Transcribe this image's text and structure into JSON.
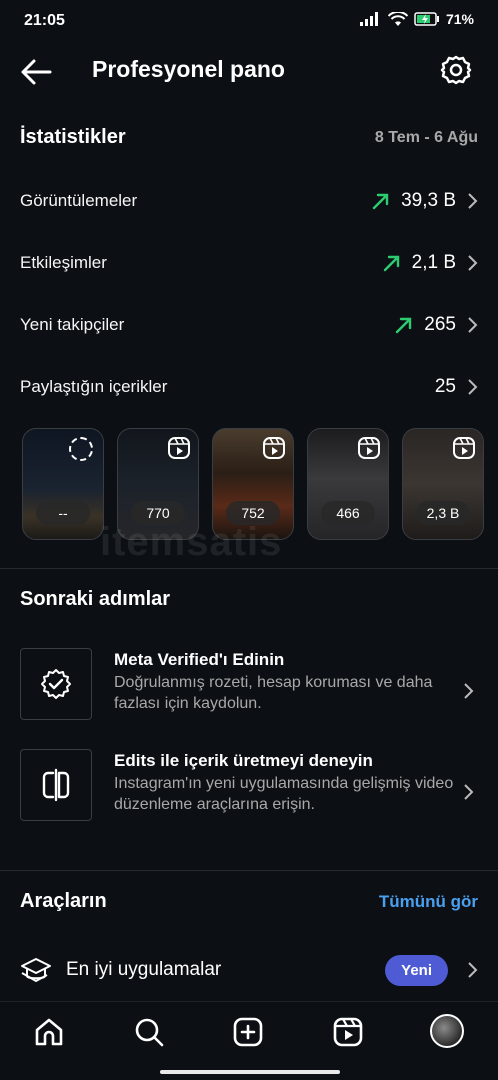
{
  "status": {
    "time": "21:05",
    "battery": "71%"
  },
  "header": {
    "title": "Profesyonel pano"
  },
  "stats": {
    "title": "İstatistikler",
    "date_range": "8 Tem - 6 Ağu",
    "rows": [
      {
        "label": "Görüntülemeler",
        "value": "39,3 B",
        "trend": "up"
      },
      {
        "label": "Etkileşimler",
        "value": "2,1 B",
        "trend": "up"
      },
      {
        "label": "Yeni takipçiler",
        "value": "265",
        "trend": "up"
      },
      {
        "label": "Paylaştığın içerikler",
        "value": "25"
      }
    ],
    "thumbnails": [
      {
        "badge": "--",
        "icon": "loading-spinner"
      },
      {
        "badge": "770",
        "icon": "reels-icon"
      },
      {
        "badge": "752",
        "icon": "reels-icon"
      },
      {
        "badge": "466",
        "icon": "reels-icon"
      },
      {
        "badge": "2,3 B",
        "icon": "reels-icon"
      }
    ]
  },
  "watermark": "itemsatis",
  "next_steps": {
    "title": "Sonraki adımlar",
    "items": [
      {
        "title": "Meta Verified'ı Edinin",
        "desc": "Doğrulanmış rozeti, hesap koruması ve daha fazlası için kaydolun.",
        "icon": "verified-badge-icon"
      },
      {
        "title": "Edits ile içerik üretmeyi deneyin",
        "desc": "Instagram'ın yeni uygulamasında gelişmiş video düzenleme araçlarına erişin.",
        "icon": "edits-app-icon"
      }
    ]
  },
  "tools": {
    "title": "Araçların",
    "see_all": "Tümünü gör",
    "items": [
      {
        "label": "En iyi uygulamalar",
        "pill": "Yeni",
        "icon": "graduation-cap-icon"
      }
    ]
  },
  "nav": [
    "home-icon",
    "search-icon",
    "create-icon",
    "reels-icon",
    "profile-avatar"
  ],
  "colors": {
    "background": "#0c1014",
    "accent_blue": "#4aa0f0",
    "trend_green": "#2ecc71",
    "pill": "#4f5bd5"
  }
}
